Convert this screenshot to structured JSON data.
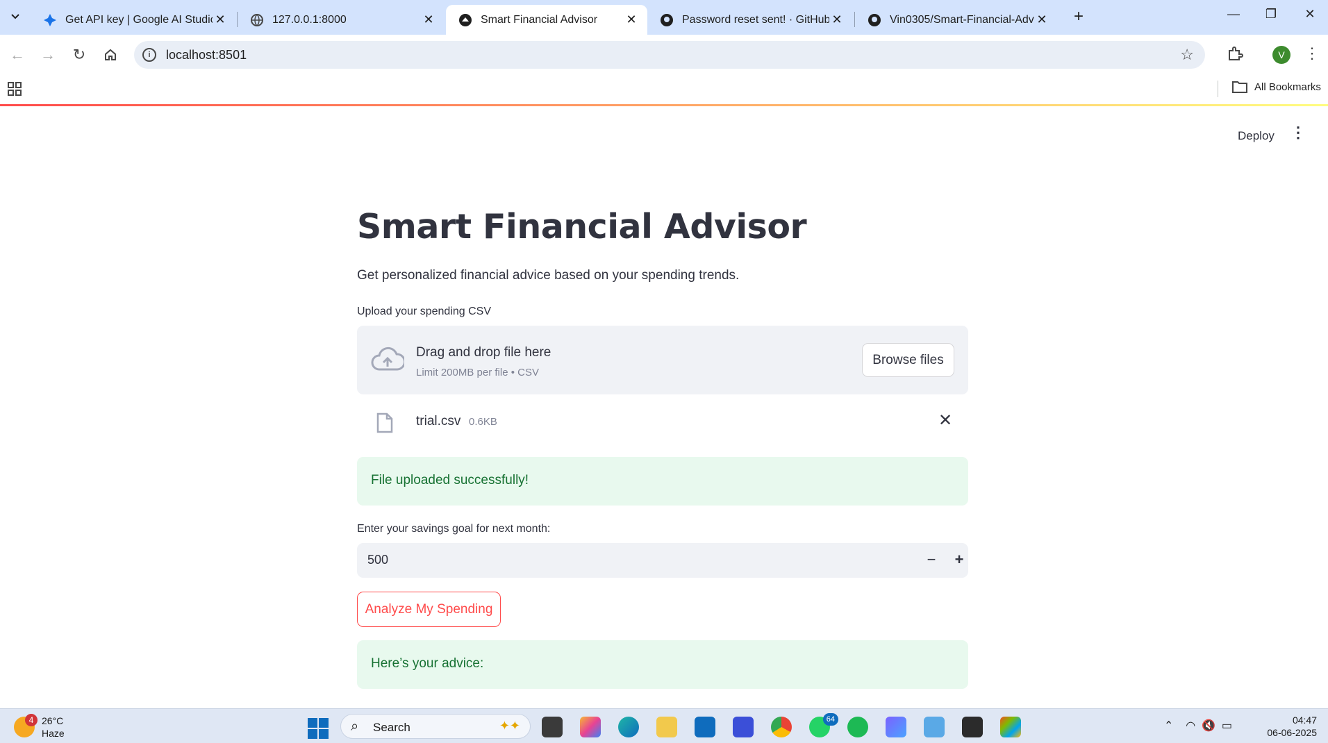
{
  "browser": {
    "tabs": [
      {
        "title": "Get API key | Google AI Studio",
        "active": false
      },
      {
        "title": "127.0.0.1:8000",
        "active": false
      },
      {
        "title": "Smart Financial Advisor",
        "active": true
      },
      {
        "title": "Password reset sent! · GitHub",
        "active": false
      },
      {
        "title": "Vin0305/Smart-Financial-Advisor",
        "active": false
      }
    ],
    "url": "localhost:8501",
    "profile_initial": "V",
    "bookmarks_label": "All Bookmarks"
  },
  "app": {
    "deploy_label": "Deploy",
    "title": "Smart Financial Advisor",
    "subtitle": "Get personalized financial advice based on your spending trends.",
    "upload": {
      "label": "Upload your spending CSV",
      "drop_text": "Drag and drop file here",
      "limit_text": "Limit 200MB per file • CSV",
      "browse_label": "Browse files",
      "file_name": "trial.csv",
      "file_size": "0.6KB"
    },
    "success_message": "File uploaded successfully!",
    "savings": {
      "label": "Enter your savings goal for next month:",
      "value": "500"
    },
    "analyze_label": "Analyze My Spending",
    "advice_message": "Here’s your advice:",
    "colors": {
      "primary": "#ff4b4b",
      "success_bg": "#e8f9ee",
      "success_text": "#177233",
      "widget_bg": "#f0f2f6"
    }
  },
  "taskbar": {
    "weather_temp": "26°C",
    "weather_desc": "Haze",
    "weather_badge": "4",
    "search_placeholder": "Search",
    "whatsapp_badge": "64",
    "time": "04:47",
    "date": "06-06-2025"
  }
}
